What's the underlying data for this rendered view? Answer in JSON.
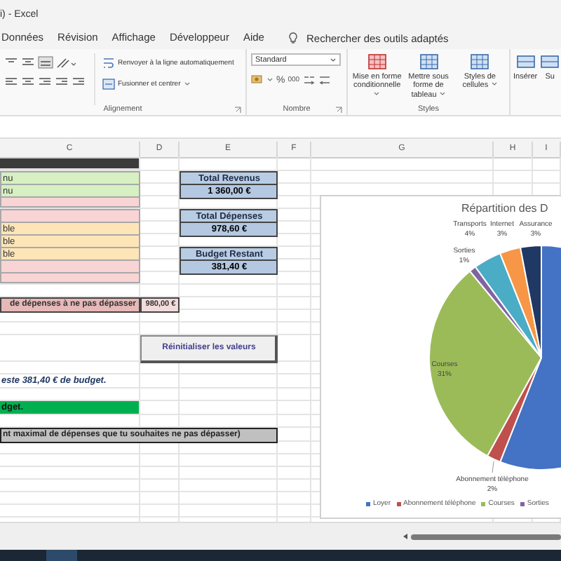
{
  "window": {
    "title": "i) - Excel"
  },
  "menu_tabs": [
    {
      "label": "Données",
      "selected": false
    },
    {
      "label": "Révision",
      "selected": false
    },
    {
      "label": "Affichage",
      "selected": false
    },
    {
      "label": "Développeur",
      "selected": false
    },
    {
      "label": "Aide",
      "selected": false
    }
  ],
  "search": {
    "label": "Rechercher des outils adaptés"
  },
  "ribbon": {
    "alignment": {
      "wrap_text": "Renvoyer à la ligne automatiquement",
      "merge_center": "Fusionner et centrer",
      "label": "Alignement"
    },
    "number": {
      "format": "Standard",
      "percent": "%",
      "thousands": "000",
      "label": "Nombre"
    },
    "styles": {
      "buttons": [
        "Mise en forme conditionnelle",
        "Mettre sous forme de tableau",
        "Styles de cellules"
      ],
      "label": "Styles"
    },
    "cells": {
      "buttons": [
        "Insérer",
        "Su"
      ]
    }
  },
  "sheet": {
    "columns": [
      "C",
      "D",
      "E",
      "F",
      "G",
      "H",
      "I"
    ],
    "rows": [
      {
        "c": {
          "kind": "header"
        }
      },
      {
        "c": {
          "kind": "income",
          "text": "nu"
        },
        "e": {
          "kind": "total_label",
          "text": "Total Revenus"
        }
      },
      {
        "c": {
          "kind": "income",
          "text": "nu"
        },
        "e": {
          "kind": "total_value",
          "text": "1 360,00 €"
        }
      },
      {
        "c": {
          "kind": "expense"
        }
      },
      {
        "c": {
          "kind": "expense"
        },
        "e": {
          "kind": "total_label",
          "text": "Total Dépenses"
        }
      },
      {
        "c": {
          "kind": "variable",
          "text": "ble"
        },
        "e": {
          "kind": "total_value",
          "text": "978,60 €"
        }
      },
      {
        "c": {
          "kind": "variable",
          "text": "ble"
        }
      },
      {
        "c": {
          "kind": "variable",
          "text": "ble"
        },
        "e": {
          "kind": "total_label",
          "text": "Budget Restant"
        }
      },
      {
        "c": {
          "kind": "expense"
        },
        "e": {
          "kind": "total_value",
          "text": "381,40 €"
        }
      },
      {
        "c": {
          "kind": "expense"
        }
      },
      {},
      {
        "c": {
          "kind": "limit_label",
          "text": "de dépenses à ne pas dépasser"
        },
        "d": {
          "kind": "limit_value",
          "text": "980,00 €"
        }
      },
      {},
      {},
      {
        "d": {
          "kind": "button",
          "text": "Réinitialiser les valeurs"
        }
      },
      {},
      {
        "c": {
          "kind": "note",
          "text": "este 381,40 € de budget."
        }
      },
      {},
      {
        "c": {
          "kind": "ok",
          "text": "dget."
        }
      },
      {},
      {
        "c": {
          "kind": "hint",
          "text": "nt maximal de dépenses que tu souhaites ne pas dépasser)"
        }
      },
      {},
      {},
      {},
      {},
      {},
      {}
    ]
  },
  "chart": {
    "chart_data": {
      "type": "pie",
      "title": "Répartition des D",
      "categories": [
        "Loyer",
        "Abonnement téléphone",
        "Courses",
        "Sorties",
        "Transports",
        "Internet",
        "Assurance"
      ],
      "values": [
        56,
        2,
        31,
        1,
        4,
        3,
        3
      ],
      "value_labels": [
        null,
        "2%",
        "31%",
        "1%",
        "4%",
        "3%",
        "3%"
      ],
      "legend": "bottom"
    }
  }
}
